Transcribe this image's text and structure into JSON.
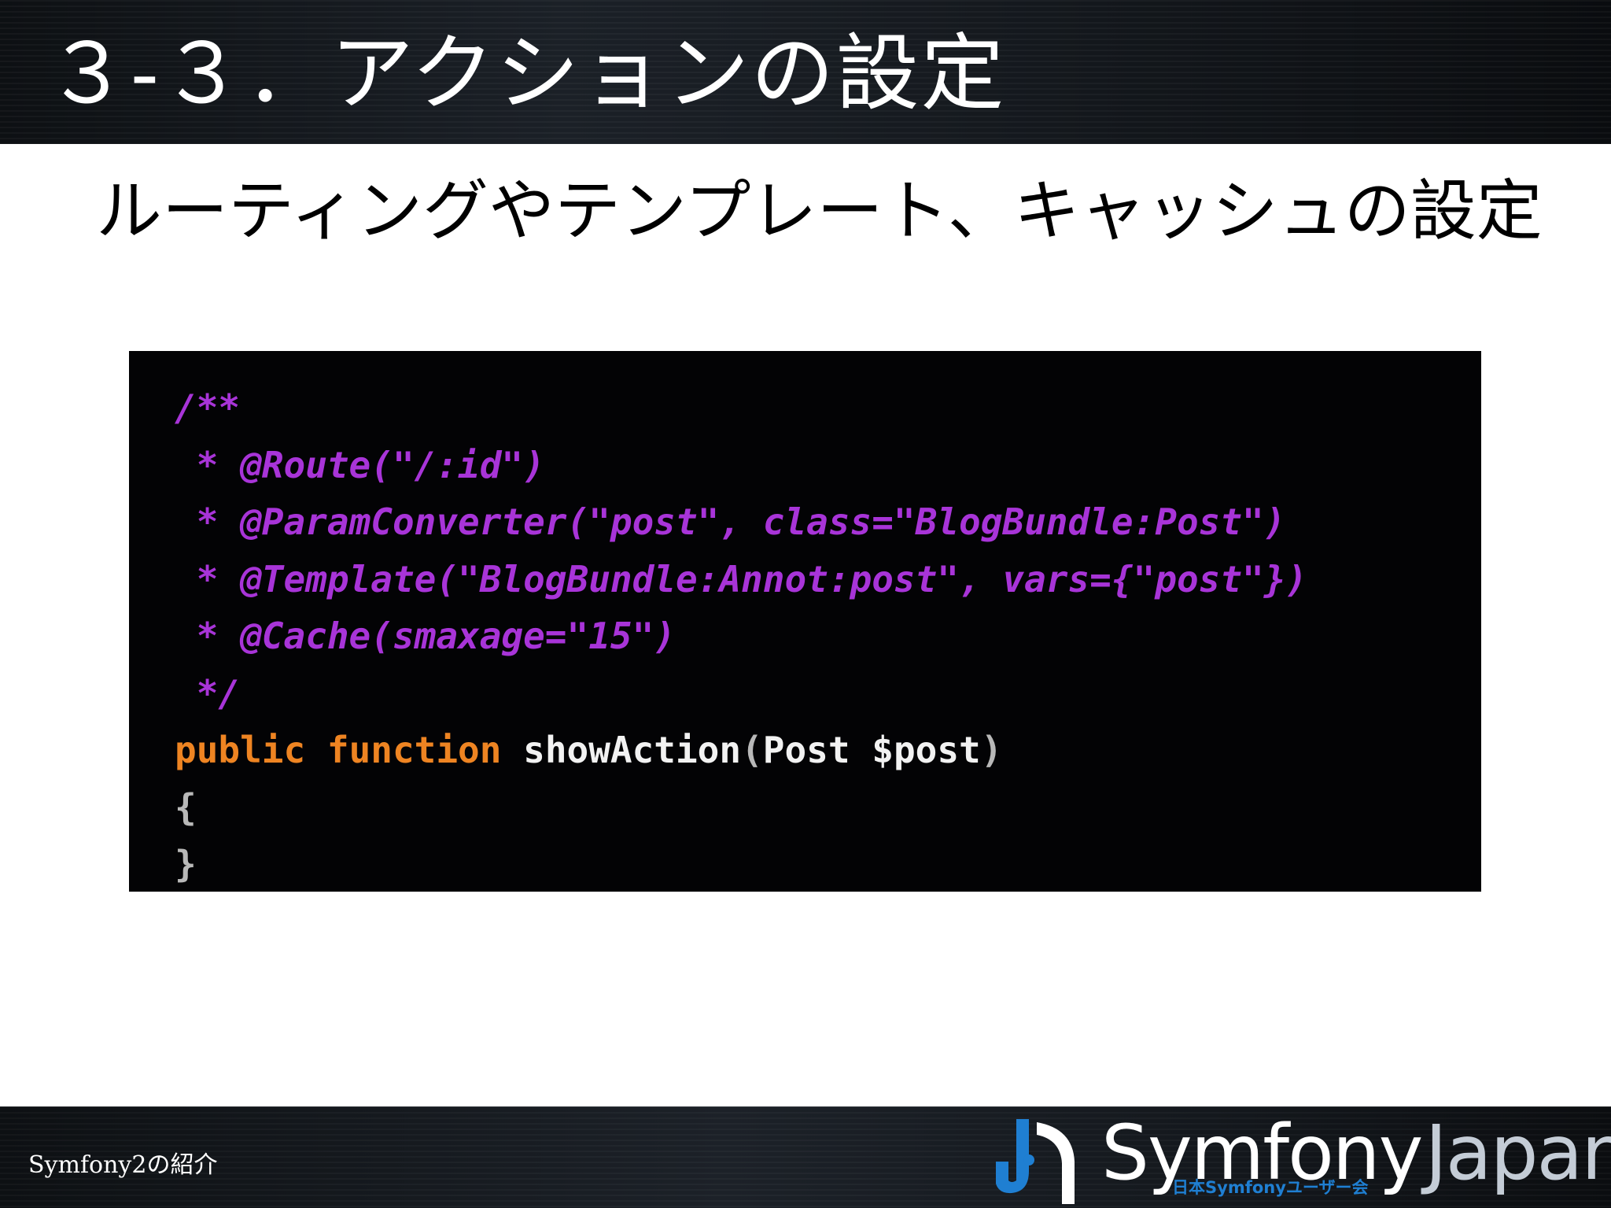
{
  "slide": {
    "title": "３-３．アクションの設定",
    "subtitle": "ルーティングやテンプレート、キャッシュの設定"
  },
  "code": {
    "lines": [
      [
        {
          "text": "/**",
          "kind": "comment"
        }
      ],
      [
        {
          "text": " * @Route(\"/:id\")",
          "kind": "comment"
        }
      ],
      [
        {
          "text": " * @ParamConverter(\"post\", class=\"BlogBundle:Post\")",
          "kind": "comment"
        }
      ],
      [
        {
          "text": " * @Template(\"BlogBundle:Annot:post\", vars={\"post\"})",
          "kind": "comment"
        }
      ],
      [
        {
          "text": " * @Cache(smaxage=\"15\")",
          "kind": "comment"
        }
      ],
      [
        {
          "text": " */",
          "kind": "comment"
        }
      ],
      [
        {
          "text": "public",
          "kind": "keyword"
        },
        {
          "text": " ",
          "kind": "plain"
        },
        {
          "text": "function",
          "kind": "keyword"
        },
        {
          "text": " showAction",
          "kind": "plain"
        },
        {
          "text": "(",
          "kind": "punct"
        },
        {
          "text": "Post $post",
          "kind": "plain"
        },
        {
          "text": ")",
          "kind": "punct"
        }
      ],
      [
        {
          "text": "{",
          "kind": "punct"
        }
      ],
      [
        {
          "text": "}",
          "kind": "punct"
        }
      ]
    ],
    "colors": {
      "comment": "#a834d8",
      "keyword": "#ee8422",
      "plain": "#f2f2f2",
      "background": "#030305"
    }
  },
  "footer": {
    "label": "Symfony2の紹介",
    "logo": {
      "icon": "symfony-japan-logo-icon",
      "brand": "Symfony",
      "region": "Japan",
      "tagline": "日本Symfonyユーザー会"
    }
  }
}
